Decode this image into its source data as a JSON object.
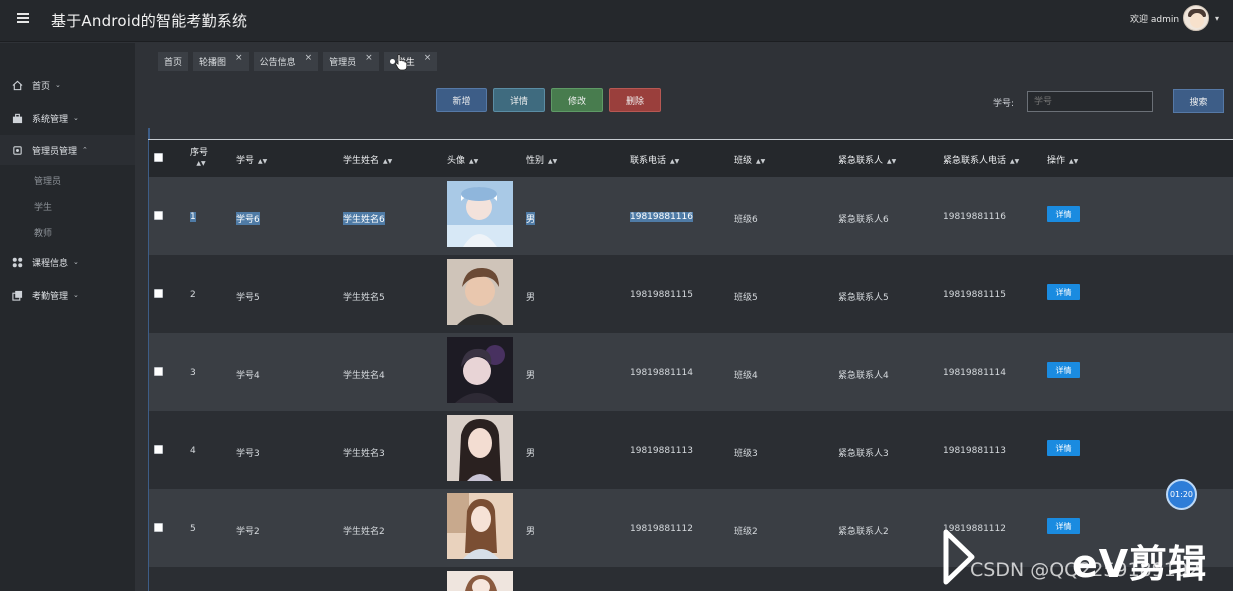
{
  "app": {
    "title": "基于Android的智能考勤系统",
    "welcome": "欢迎 admin"
  },
  "sidebar": {
    "items": [
      {
        "label": "首页",
        "icon": "home-icon"
      },
      {
        "label": "系统管理",
        "icon": "briefcase-icon"
      },
      {
        "label": "管理员管理",
        "icon": "settings-icon"
      },
      {
        "label": "课程信息",
        "icon": "grid-icon"
      },
      {
        "label": "考勤管理",
        "icon": "copy-icon"
      }
    ],
    "subitems": [
      "管理员",
      "学生",
      "教师"
    ]
  },
  "tabs": [
    {
      "label": "首页",
      "closable": false
    },
    {
      "label": "轮播图",
      "closable": true
    },
    {
      "label": "公告信息",
      "closable": true
    },
    {
      "label": "管理员",
      "closable": true
    },
    {
      "label": "学生",
      "closable": true,
      "active": true
    }
  ],
  "toolbar": {
    "add": "新增",
    "detail": "详情",
    "edit": "修改",
    "delete": "删除"
  },
  "search": {
    "label": "学号:",
    "placeholder": "学号",
    "button": "搜索"
  },
  "table": {
    "headers": {
      "index": "序号",
      "student_no": "学号",
      "student_name": "学生姓名",
      "avatar": "头像",
      "gender": "性别",
      "phone": "联系电话",
      "class": "班级",
      "emergency_contact": "紧急联系人",
      "emergency_phone": "紧急联系人电话",
      "action": "操作"
    },
    "rows": [
      {
        "index": "1",
        "student_no": "学号6",
        "student_name": "学生姓名6",
        "gender": "男",
        "phone": "19819881116",
        "class": "班级6",
        "emergency_contact": "紧急联系人6",
        "emergency_phone": "19819881116",
        "action": "详情"
      },
      {
        "index": "2",
        "student_no": "学号5",
        "student_name": "学生姓名5",
        "gender": "男",
        "phone": "19819881115",
        "class": "班级5",
        "emergency_contact": "紧急联系人5",
        "emergency_phone": "19819881115",
        "action": "详情"
      },
      {
        "index": "3",
        "student_no": "学号4",
        "student_name": "学生姓名4",
        "gender": "男",
        "phone": "19819881114",
        "class": "班级4",
        "emergency_contact": "紧急联系人4",
        "emergency_phone": "19819881114",
        "action": "详情"
      },
      {
        "index": "4",
        "student_no": "学号3",
        "student_name": "学生姓名3",
        "gender": "男",
        "phone": "19819881113",
        "class": "班级3",
        "emergency_contact": "紧急联系人3",
        "emergency_phone": "19819881113",
        "action": "详情"
      },
      {
        "index": "5",
        "student_no": "学号2",
        "student_name": "学生姓名2",
        "gender": "男",
        "phone": "19819881112",
        "class": "班级2",
        "emergency_contact": "紧急联系人2",
        "emergency_phone": "19819881112",
        "action": "详情"
      }
    ]
  },
  "overlay": {
    "timer": "01:20",
    "watermark": "CSDN @QQ2259189102",
    "brand": "eV剪辑"
  },
  "colors": {
    "accent": "#3d5d87",
    "detail_btn": "#1a8be0",
    "delete_btn": "#9a3f3c",
    "edit_btn": "#487c4e",
    "selection": "#4f7ba6"
  }
}
